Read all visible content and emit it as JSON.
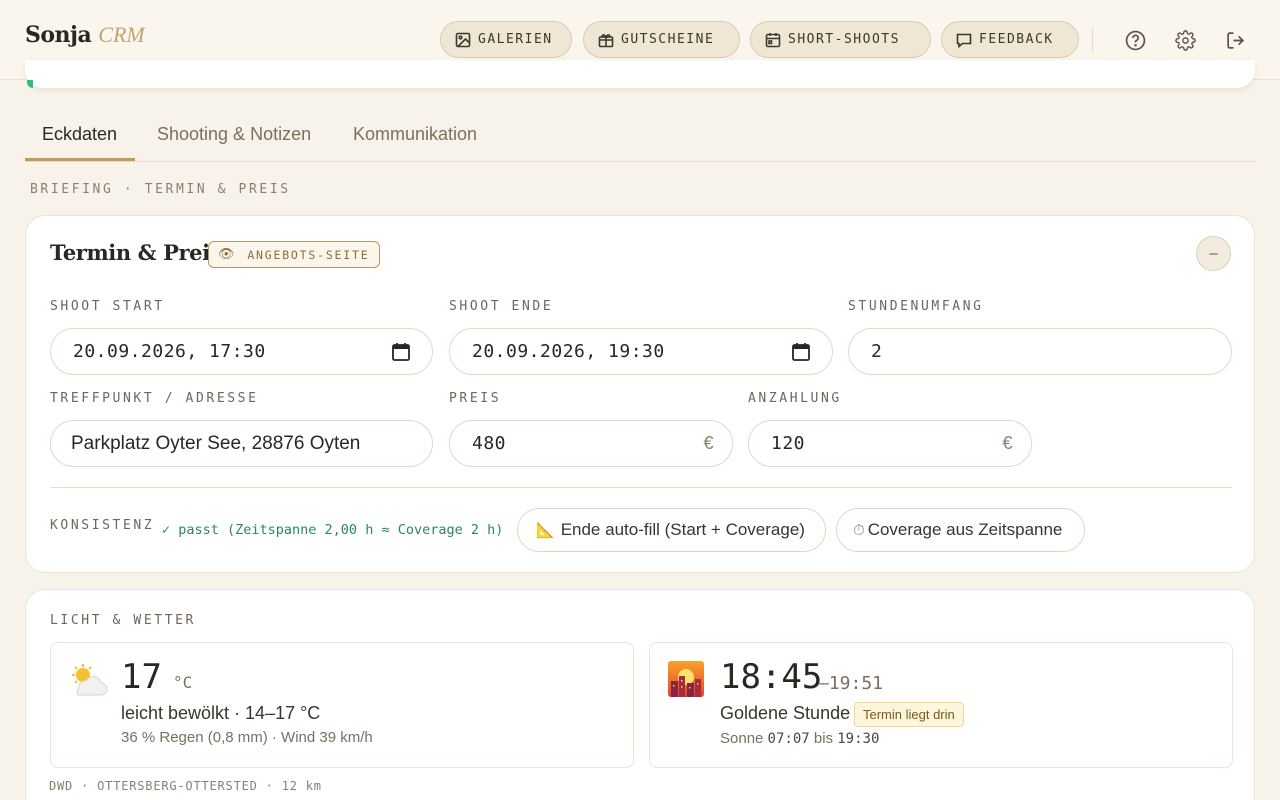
{
  "app": {
    "name": "Sonja",
    "subtitle": "CRM"
  },
  "nav": [
    {
      "label": "GALERIEN",
      "icon": "image-icon"
    },
    {
      "label": "GUTSCHEINE",
      "icon": "gift-icon"
    },
    {
      "label": "SHORT-SHOOTS",
      "icon": "calendar-icon"
    },
    {
      "label": "FEEDBACK",
      "icon": "message-icon"
    }
  ],
  "header_icons": [
    "help-icon",
    "gear-icon",
    "logout-icon"
  ],
  "tabs": [
    {
      "label": "Eckdaten",
      "active": true
    },
    {
      "label": "Shooting & Notizen",
      "active": false
    },
    {
      "label": "Kommunikation",
      "active": false
    }
  ],
  "briefing_label": "BRIEFING · TERMIN & PREIS",
  "termin": {
    "title": "Termin & Preis",
    "badge": "ANGEBOTS-SEITE",
    "collapse": "–",
    "shoot_start": {
      "label": "SHOOT START",
      "value": "20.09.2026, 17:30"
    },
    "shoot_ende": {
      "label": "SHOOT ENDE",
      "value": "20.09.2026, 19:30"
    },
    "stundenumfang": {
      "label": "STUNDENUMFANG",
      "value": "2"
    },
    "adresse": {
      "label": "TREFFPUNKT / ADRESSE",
      "value": "Parkplatz Oyter See, 28876 Oyten"
    },
    "preis": {
      "label": "PREIS",
      "value": "480",
      "currency": "€"
    },
    "anzahlung": {
      "label": "ANZAHLUNG",
      "value": "120",
      "currency": "€"
    },
    "konsistenz_label": "KONSISTENZ",
    "konsistenz_status": "✓ passt (Zeitspanne 2,00 h ≈ Coverage 2 h)",
    "autofill_button": "Ende auto-fill (Start + Coverage)",
    "coverage_button": "Coverage aus Zeitspanne"
  },
  "licht": {
    "label": "LICHT & WETTER",
    "weather": {
      "temp": "17",
      "unit": "°C",
      "desc": "leicht bewölkt · 14–17 °C",
      "details": "36 % Regen (0,8 mm) · Wind 39 km/h"
    },
    "golden": {
      "start": "18:45",
      "end": "–19:51",
      "desc": "Goldene Stunde",
      "badge": "Termin liegt drin",
      "sun_prefix": "Sonne",
      "sunrise": "07:07",
      "sun_mid": "bis",
      "sunset": "19:30"
    },
    "source": "DWD · OTTERSBERG-OTTERSTED · 12 km"
  },
  "colors": {
    "accent": "#c29a5b",
    "ok": "#2a8a55",
    "background": "#f7f3ea"
  }
}
